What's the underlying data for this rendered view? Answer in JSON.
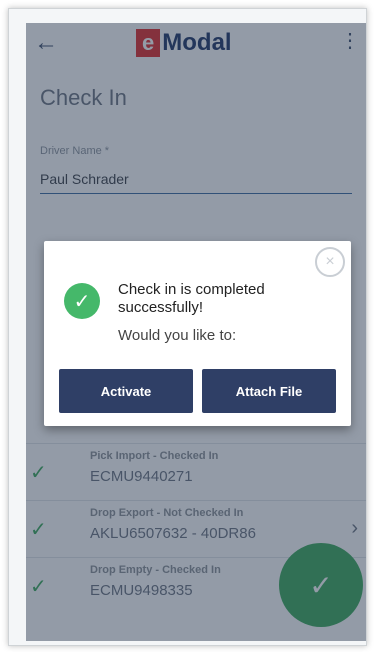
{
  "app": {
    "logo": {
      "e_letter": "e",
      "rest": "Modal"
    },
    "title": "Check In",
    "driver": {
      "label": "Driver Name *",
      "value": "Paul Schrader"
    }
  },
  "list": [
    {
      "status": "Pick Import - Checked In",
      "container": "ECMU9440271",
      "chevron": false
    },
    {
      "status": "Drop Export - Not Checked In",
      "container": "AKLU6507632 - 40DR86",
      "chevron": true
    },
    {
      "status": "Drop Empty - Checked In",
      "container": "ECMU9498335",
      "chevron": false
    }
  ],
  "dialog": {
    "message": "Check in is completed successfully!",
    "question": "Would you like to:",
    "buttons": {
      "activate": "Activate",
      "attach": "Attach File"
    }
  },
  "icons": {
    "back": "back-arrow-icon",
    "menu": "kebab-menu-icon",
    "success": "check-circle-icon",
    "close": "close-circle-icon",
    "fab": "check-icon",
    "chevron": "chevron-right-icon"
  },
  "colors": {
    "brand_red": "#e02a2a",
    "brand_navy": "#1f3566",
    "button_navy": "#2f3f66",
    "success_green": "#3aa95a"
  }
}
